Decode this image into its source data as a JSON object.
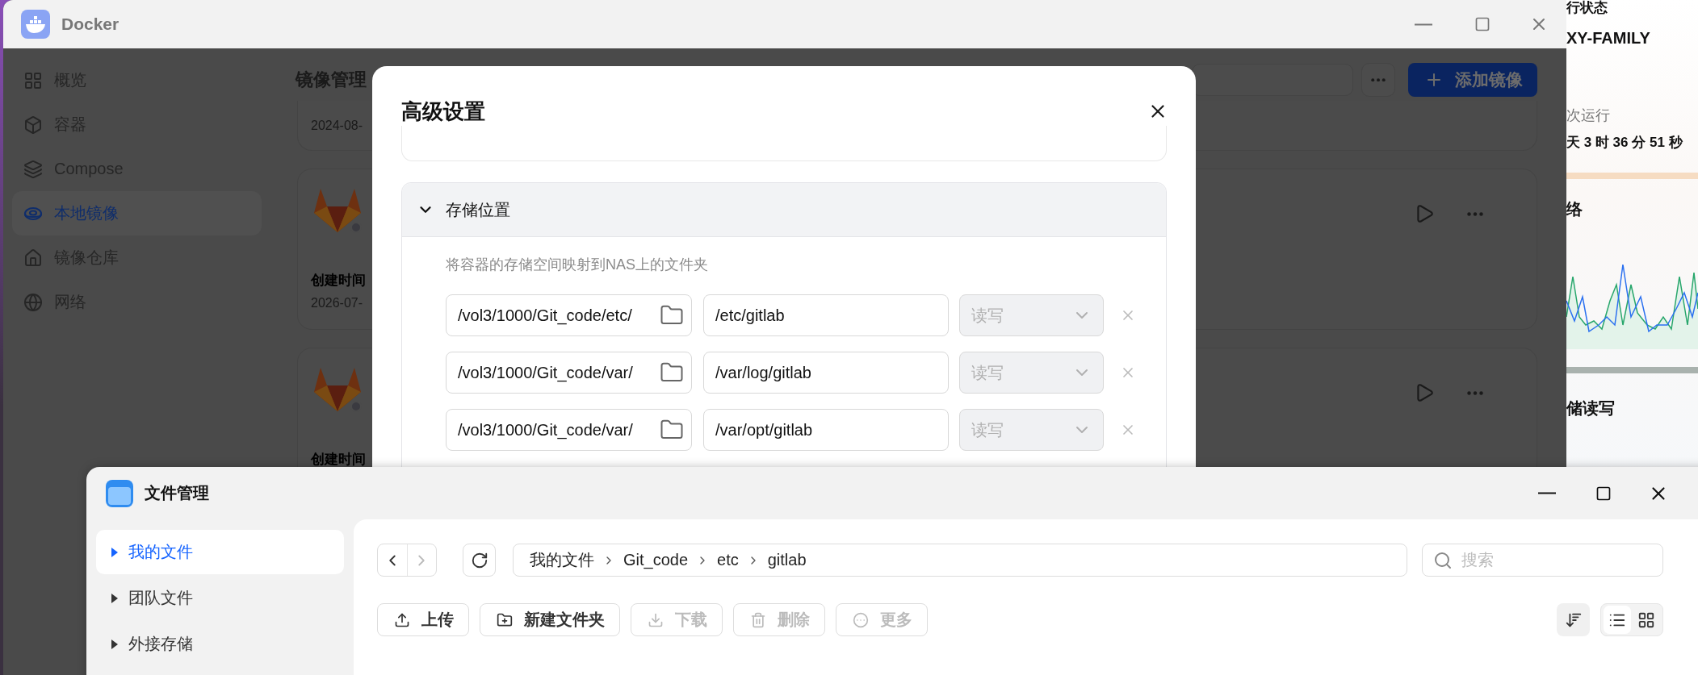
{
  "desktop_widget": {
    "title": "行状态",
    "device": "XY-FAMILY",
    "uptime_label": "次运行",
    "uptime": "天 3 时 36 分 51 秒",
    "network_title": "络",
    "storage_title": "储读写"
  },
  "docker": {
    "title": "Docker",
    "sidebar": [
      {
        "label": "概览",
        "selected": false
      },
      {
        "label": "容器",
        "selected": false
      },
      {
        "label": "Compose",
        "selected": false
      },
      {
        "label": "本地镜像",
        "selected": true
      },
      {
        "label": "镜像仓库",
        "selected": false
      },
      {
        "label": "网络",
        "selected": false
      }
    ],
    "page_title": "镜像管理",
    "add_button": "添加镜像",
    "cards": [
      {
        "kind": "top_cut",
        "date": "2024-08-"
      },
      {
        "kind": "image",
        "label": "创建时间",
        "date": "2026-07-"
      },
      {
        "kind": "image",
        "label": "创建时间"
      }
    ]
  },
  "modal": {
    "title": "高级设置",
    "section": {
      "title": "存储位置",
      "expanded": true,
      "description": "将容器的存储空间映射到NAS上的文件夹",
      "mounts": [
        {
          "host": "/vol3/1000/Git_code/etc/",
          "container": "/etc/gitlab",
          "mode": "读写",
          "disabled": true
        },
        {
          "host": "/vol3/1000/Git_code/var/",
          "container": "/var/log/gitlab",
          "mode": "读写",
          "disabled": true
        },
        {
          "host": "/vol3/1000/Git_code/var/",
          "container": "/var/opt/gitlab",
          "mode": "读写",
          "disabled": true
        }
      ]
    }
  },
  "file_manager": {
    "title": "文件管理",
    "sidebar": [
      {
        "label": "我的文件",
        "selected": true
      },
      {
        "label": "团队文件",
        "selected": false
      },
      {
        "label": "外接存储",
        "selected": false
      }
    ],
    "nav": {
      "back_disabled": false,
      "forward_disabled": true
    },
    "breadcrumb": [
      "我的文件",
      "Git_code",
      "etc",
      "gitlab"
    ],
    "search": {
      "placeholder": "搜索"
    },
    "toolbar": [
      {
        "label": "上传",
        "disabled": false
      },
      {
        "label": "新建文件夹",
        "disabled": false
      },
      {
        "label": "下载",
        "disabled": true
      },
      {
        "label": "删除",
        "disabled": true
      },
      {
        "label": "更多",
        "disabled": true
      }
    ],
    "view_modes": [
      {
        "kind": "list",
        "selected": true
      },
      {
        "kind": "grid",
        "selected": false
      }
    ]
  }
}
